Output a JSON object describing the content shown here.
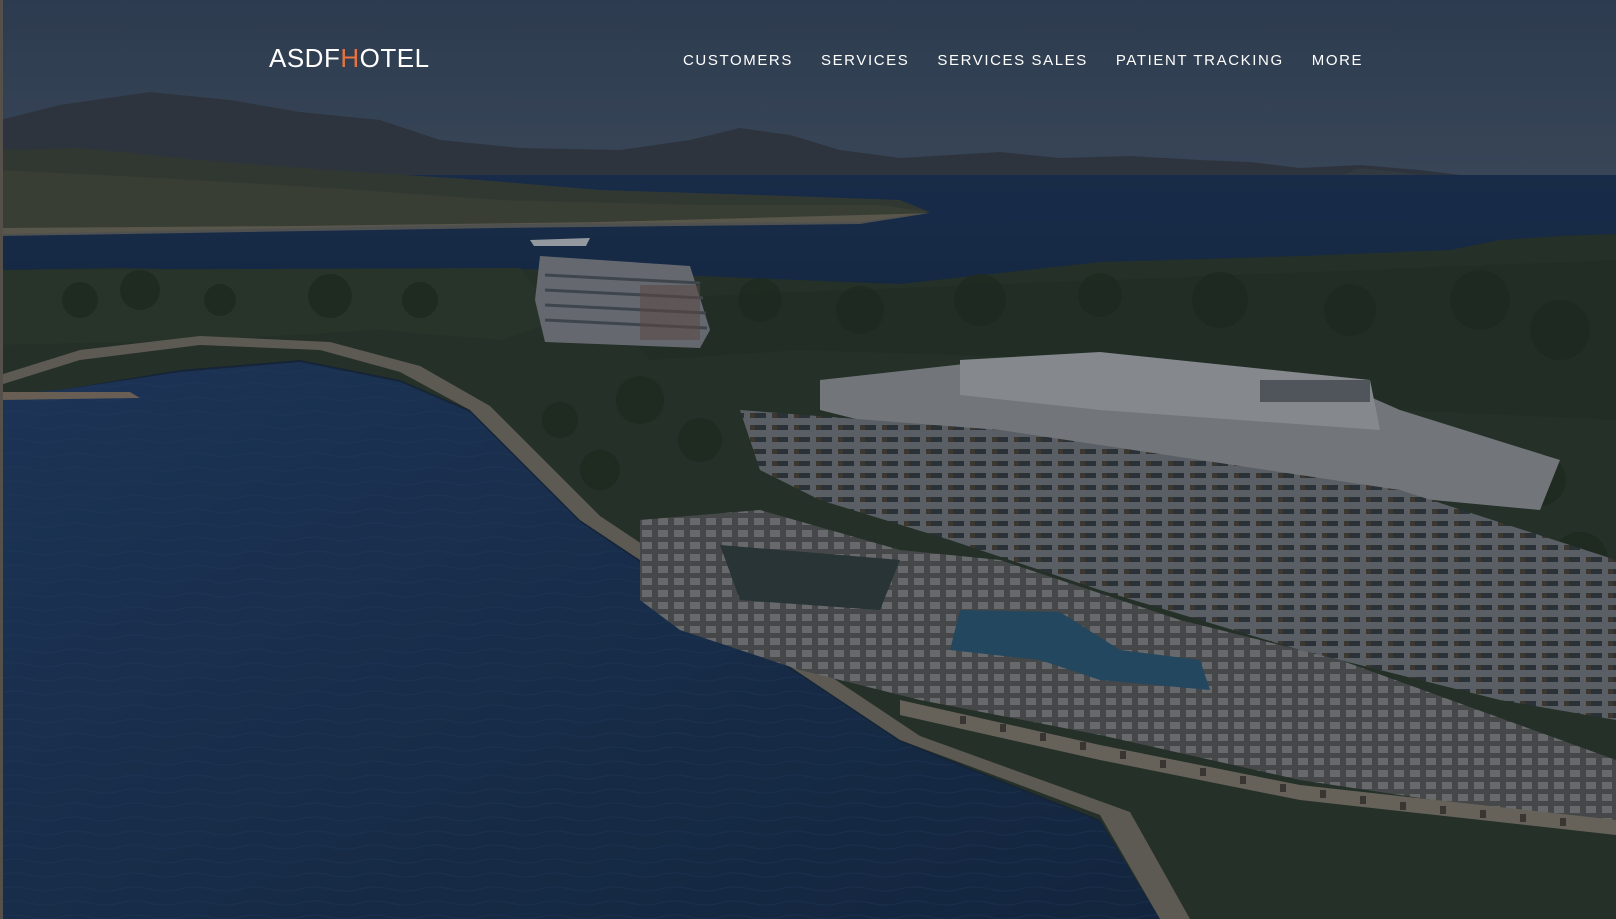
{
  "brand": {
    "logo_part1": "ASDF",
    "logo_accent": "H",
    "logo_part2": "OTEL",
    "accent_color": "#e9733f"
  },
  "nav": {
    "items": [
      {
        "label": "CUSTOMERS"
      },
      {
        "label": "SERVICES"
      },
      {
        "label": "SERVICES SALES"
      },
      {
        "label": "PATIENT TRACKING"
      },
      {
        "label": "MORE"
      }
    ]
  },
  "hero": {
    "image_subject": "aerial-photo-coastal-resort",
    "overlay_color": "#0b1424"
  }
}
